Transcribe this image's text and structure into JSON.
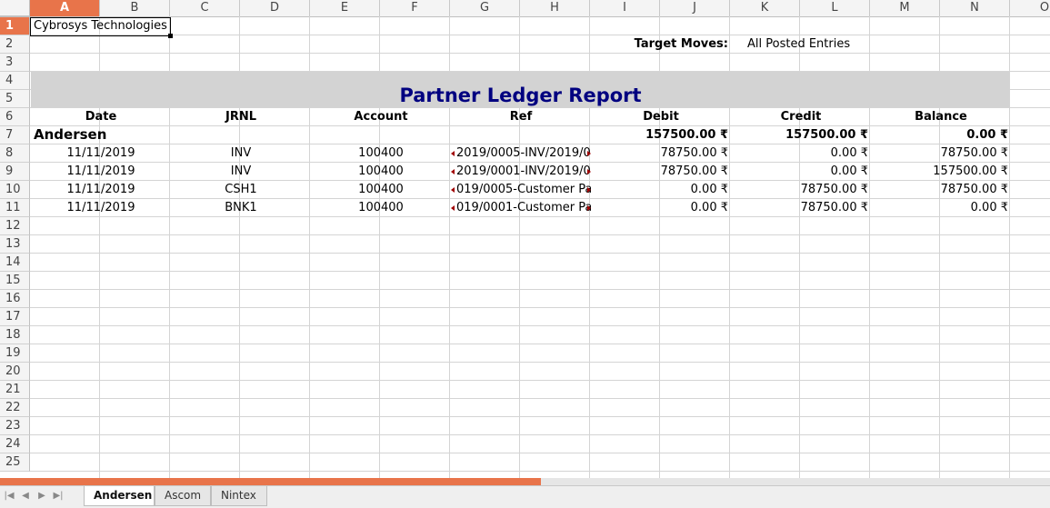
{
  "columns": [
    "A",
    "B",
    "C",
    "D",
    "E",
    "F",
    "G",
    "H",
    "I",
    "J",
    "K",
    "L",
    "M",
    "N",
    "O"
  ],
  "rows": [
    "1",
    "2",
    "3",
    "4",
    "5",
    "6",
    "7",
    "8",
    "9",
    "10",
    "11",
    "12",
    "13",
    "14",
    "15",
    "16",
    "17",
    "18",
    "19",
    "20",
    "21",
    "22",
    "23",
    "24",
    "25"
  ],
  "sheet": {
    "company": "Cybrosys Technologies",
    "target_moves_label": "Target Moves:",
    "target_moves_value": "All Posted Entries",
    "report_title": "Partner Ledger Report",
    "headers": {
      "date": "Date",
      "jrnl": "JRNL",
      "account": "Account",
      "ref": "Ref",
      "debit": "Debit",
      "credit": "Credit",
      "balance": "Balance"
    },
    "partner": {
      "name": "Andersen",
      "debit": "157500.00 ₹",
      "credit": "157500.00 ₹",
      "balance": "0.00 ₹"
    },
    "lines": [
      {
        "date": "11/11/2019",
        "jrnl": "INV",
        "account": "100400",
        "ref": "2019/0005-INV/2019/0",
        "debit": "78750.00 ₹",
        "credit": "0.00 ₹",
        "balance": "78750.00 ₹"
      },
      {
        "date": "11/11/2019",
        "jrnl": "INV",
        "account": "100400",
        "ref": "2019/0001-INV/2019/0",
        "debit": "78750.00 ₹",
        "credit": "0.00 ₹",
        "balance": "157500.00 ₹"
      },
      {
        "date": "11/11/2019",
        "jrnl": "CSH1",
        "account": "100400",
        "ref": "019/0005-Customer Pa",
        "debit": "0.00 ₹",
        "credit": "78750.00 ₹",
        "balance": "78750.00 ₹"
      },
      {
        "date": "11/11/2019",
        "jrnl": "BNK1",
        "account": "100400",
        "ref": "019/0001-Customer Pa",
        "debit": "0.00 ₹",
        "credit": "78750.00 ₹",
        "balance": "0.00 ₹"
      }
    ]
  },
  "tabs": [
    {
      "label": "Andersen",
      "active": true
    },
    {
      "label": "Ascom",
      "active": false
    },
    {
      "label": "Nintex",
      "active": false
    }
  ],
  "nav_icons": [
    "first-sheet-icon",
    "prev-sheet-icon",
    "next-sheet-icon",
    "last-sheet-icon"
  ],
  "colors": {
    "accent": "#e8744a",
    "title": "#000080",
    "banner": "#d3d3d3"
  }
}
